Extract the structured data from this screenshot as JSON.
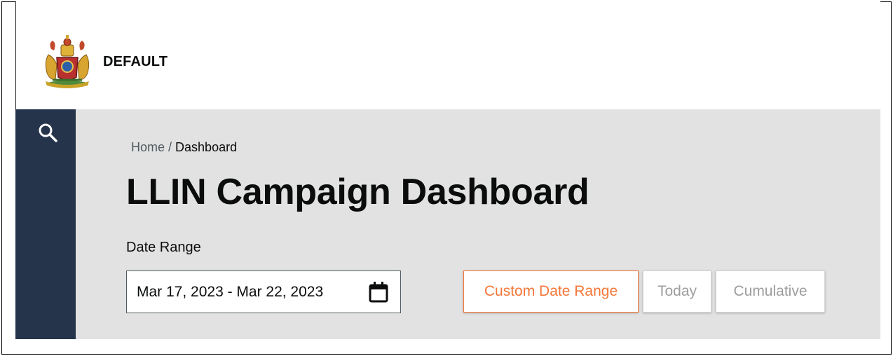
{
  "header": {
    "brand_name": "DEFAULT",
    "logo_icon": "state-emblem-icon"
  },
  "sidebar": {
    "search_icon": "search-icon"
  },
  "breadcrumb": {
    "home": "Home",
    "separator": "/",
    "current": "Dashboard"
  },
  "page": {
    "title": "LLIN Campaign Dashboard"
  },
  "date_range": {
    "label": "Date Range",
    "value": "Mar 17, 2023 - Mar 22, 2023",
    "calendar_icon": "calendar-icon"
  },
  "range_options": {
    "custom": "Custom Date Range",
    "today": "Today",
    "cumulative": "Cumulative",
    "selected": "custom"
  },
  "colors": {
    "sidebar": "#25344a",
    "content_bg": "#e2e2e2",
    "accent": "#f47738",
    "muted_text": "#9e9e9e"
  }
}
